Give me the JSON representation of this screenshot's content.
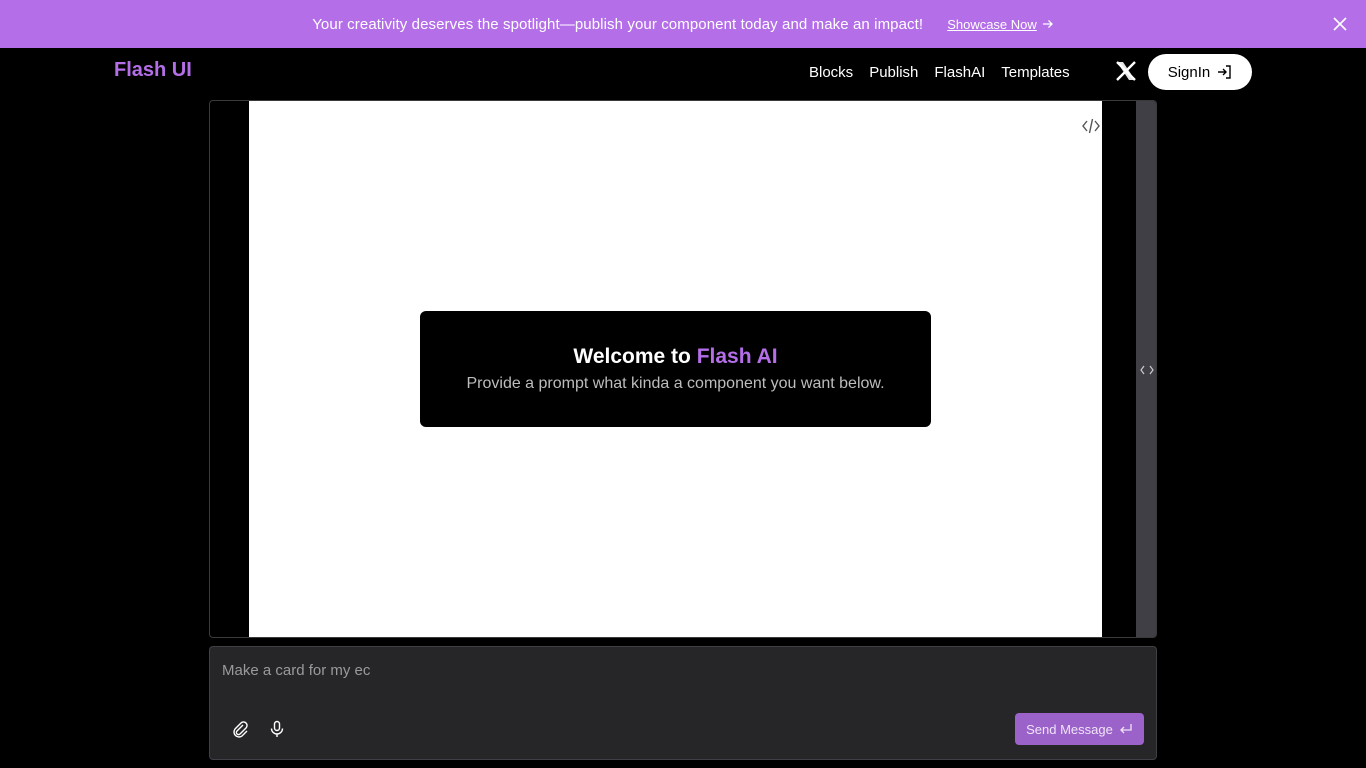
{
  "banner": {
    "text": "Your creativity deserves the spotlight—publish your component today and make an impact!",
    "link_label": "Showcase Now",
    "close_icon": "close-icon"
  },
  "nav": {
    "logo": "Flash UI",
    "links": [
      "Blocks",
      "Publish",
      "FlashAI",
      "Templates"
    ],
    "social_icon": "x-logo-icon",
    "signin_label": "SignIn"
  },
  "preview": {
    "code_icon": "code-icon",
    "welcome_prefix": "Welcome to ",
    "welcome_brand": "Flash AI",
    "welcome_subtitle": "Provide a prompt what kinda a component you want below."
  },
  "composer": {
    "input_value": "Make a card for my ec",
    "send_label": "Send Message"
  },
  "colors": {
    "accent": "#b46ee8",
    "background": "#000000",
    "send_button": "#9b63c9"
  }
}
